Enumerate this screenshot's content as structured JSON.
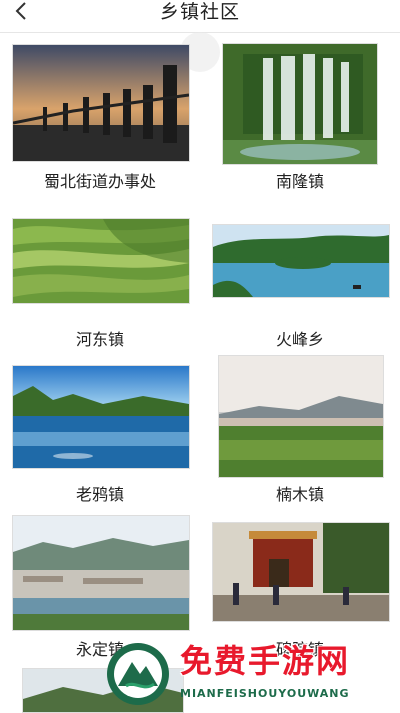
{
  "header": {
    "title": "乡镇社区",
    "back_icon": "chevron-left-icon"
  },
  "towns": [
    {
      "name": "蜀北街道办事处"
    },
    {
      "name": "南隆镇"
    },
    {
      "name": "河东镇"
    },
    {
      "name": "火峰乡"
    },
    {
      "name": "老鸦镇"
    },
    {
      "name": "楠木镇"
    },
    {
      "name": "永定镇"
    },
    {
      "name": "碑院镇"
    }
  ],
  "watermark": {
    "title": "免费手游网",
    "subtitle": "MIANFEISHOUYOUWANG"
  },
  "colors": {
    "watermark_red": "#e8192c",
    "watermark_green": "#1d6b4a"
  }
}
